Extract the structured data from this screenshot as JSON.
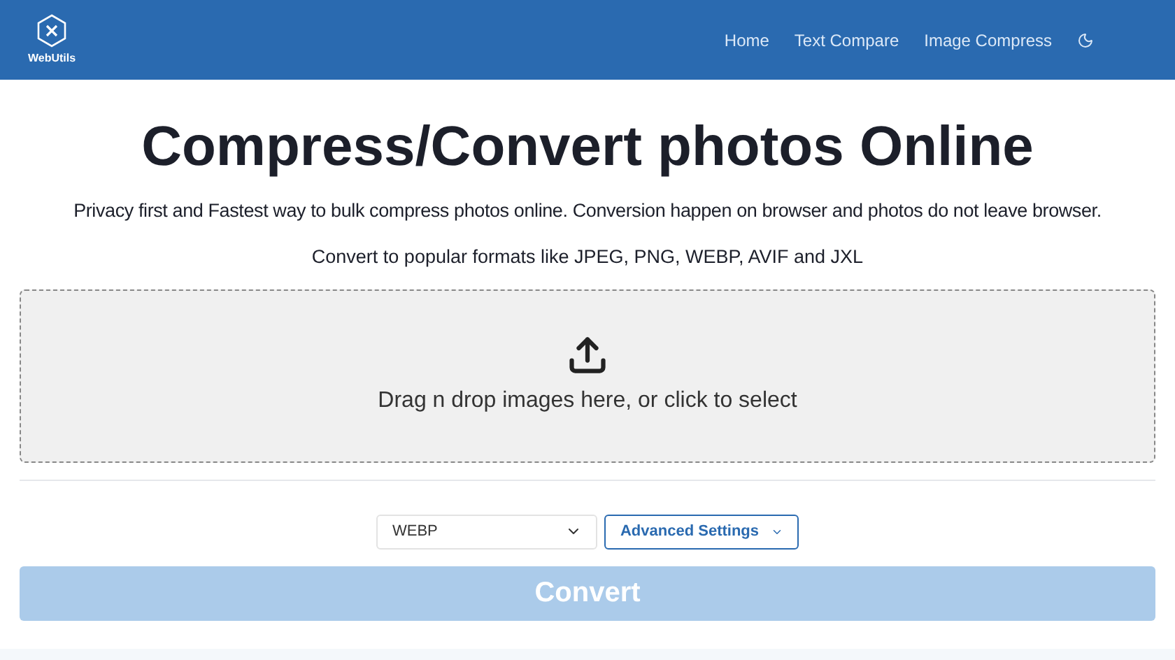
{
  "header": {
    "logo_text": "WebUtils",
    "nav": [
      {
        "label": "Home"
      },
      {
        "label": "Text Compare"
      },
      {
        "label": "Image Compress"
      }
    ]
  },
  "title": "Compress/Convert photos Online",
  "subtitle": "Privacy first and Fastest way to bulk compress photos online. Conversion happen on browser and photos do not leave browser.",
  "formats_note": "Convert to popular formats like JPEG, PNG, WEBP, AVIF and JXL",
  "dropzone": {
    "text": "Drag n drop images here, or click to select"
  },
  "format_select": {
    "value": "WEBP"
  },
  "advanced_button": {
    "label": "Advanced Settings",
    "expanded": false
  },
  "convert_button": {
    "label": "Convert",
    "disabled": true
  }
}
